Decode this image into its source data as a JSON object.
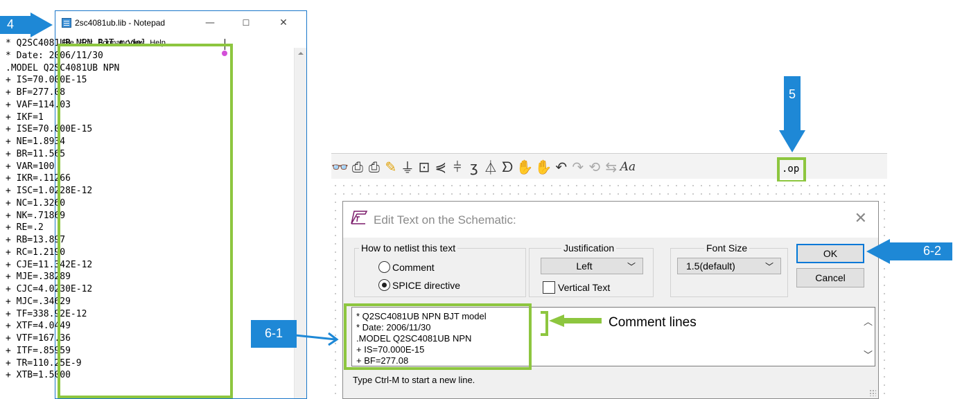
{
  "notepad": {
    "title": "2sc4081ub.lib - Notepad",
    "minimize_glyph": "—",
    "maximize_glyph": "☐",
    "close_glyph": "✕",
    "menu": [
      "File",
      "Edit",
      "Format",
      "View",
      "Help"
    ],
    "lines": [
      "* Q2SC4081UB NPN BJT model",
      "* Date: 2006/11/30",
      ".MODEL Q2SC4081UB NPN",
      "+ IS=70.000E-15",
      "+ BF=277.08",
      "+ VAF=114.03",
      "+ IKF=1",
      "+ ISE=70.000E-15",
      "+ NE=1.8934",
      "+ BR=11.565",
      "+ VAR=100",
      "+ IKR=.11266",
      "+ ISC=1.0228E-12",
      "+ NC=1.3260",
      "+ NK=.71869",
      "+ RE=.2",
      "+ RB=13.897",
      "+ RC=1.2190",
      "+ CJE=11.342E-12",
      "+ MJE=.38289",
      "+ CJC=4.0230E-12",
      "+ MJC=.34629",
      "+ TF=338.92E-12",
      "+ XTF=4.0449",
      "+ VTF=167.36",
      "+ ITF=.85959",
      "+ TR=110.25E-9",
      "+ XTB=1.5000"
    ]
  },
  "callouts": {
    "step4": "4",
    "step5": "5",
    "step6_1": "6-1",
    "step6_2": "6-2",
    "comment_lines": "Comment lines"
  },
  "toolbar": {
    "icons": [
      "binoculars-icon",
      "print-setup-icon",
      "print-icon",
      "pencil-icon",
      "ground-icon",
      "label-net-icon",
      "resistor-icon",
      "capacitor-icon",
      "inductor-icon",
      "diode-icon",
      "component-icon",
      "move-hand-icon",
      "drag-hand-icon",
      "undo-icon",
      "redo-icon",
      "rotate-icon",
      "mirror-icon",
      "text-icon",
      "spice-directive-icon"
    ],
    "op_label": ".op"
  },
  "dialog": {
    "title": "Edit Text on the Schematic:",
    "close_glyph": "✕",
    "netlist_group": "How to netlist this text",
    "radio_comment": "Comment",
    "radio_spice": "SPICE directive",
    "selected_mode": "SPICE directive",
    "justification_group": "Justification",
    "justification_value": "Left",
    "vertical_text": "Vertical Text",
    "font_size_group": "Font Size",
    "font_size_value": "1.5(default)",
    "ok_label": "OK",
    "cancel_label": "Cancel",
    "text_lines": [
      "* Q2SC4081UB NPN BJT model",
      "* Date: 2006/11/30",
      ".MODEL Q2SC4081UB NPN",
      "+ IS=70.000E-15",
      "+ BF=277.08"
    ],
    "hint": "Type Ctrl-M to start a new line."
  },
  "colors": {
    "highlight_green": "#8dc63f",
    "callout_blue": "#1e88d6"
  }
}
